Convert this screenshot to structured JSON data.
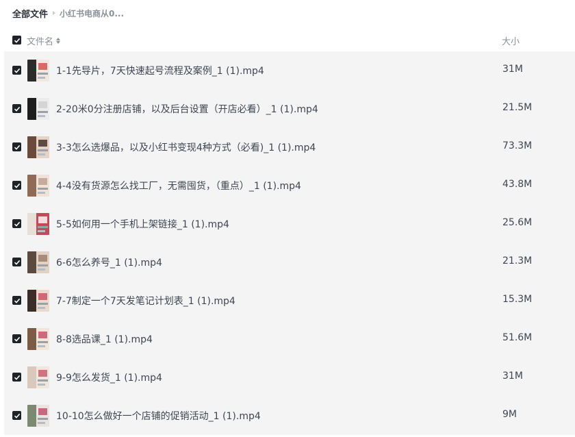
{
  "breadcrumb": {
    "root": "全部文件",
    "current": "小红书电商从0..."
  },
  "header": {
    "name_label": "文件名",
    "size_label": "大小",
    "sort_icon": "sort-icon",
    "checked": true
  },
  "files": [
    {
      "name": "1-1先导片，7天快速起号流程及案例_1 (1).mp4",
      "size": "31M",
      "checked": true,
      "thumbnail": "video-thumbnail"
    },
    {
      "name": "2-20米0分注册店铺，以及后台设置（开店必看）_1 (1).mp4",
      "size": "21.5M",
      "checked": true,
      "thumbnail": "video-thumbnail"
    },
    {
      "name": "3-3怎么选爆品，以及小红书变现4种方式（必看)_1 (1).mp4",
      "size": "73.3M",
      "checked": true,
      "thumbnail": "video-thumbnail"
    },
    {
      "name": "4-4没有货源怎么找工厂，无需囤货，（重点）_1 (1).mp4",
      "size": "43.8M",
      "checked": true,
      "thumbnail": "video-thumbnail"
    },
    {
      "name": "5-5如何用一个手机上架链接_1 (1).mp4",
      "size": "25.6M",
      "checked": true,
      "thumbnail": "video-thumbnail"
    },
    {
      "name": "6-6怎么养号_1 (1).mp4",
      "size": "21.3M",
      "checked": true,
      "thumbnail": "video-thumbnail"
    },
    {
      "name": "7-7制定一个7天发笔记计划表_1 (1).mp4",
      "size": "15.3M",
      "checked": true,
      "thumbnail": "video-thumbnail"
    },
    {
      "name": "8-8选品课_1 (1).mp4",
      "size": "51.6M",
      "checked": true,
      "thumbnail": "video-thumbnail"
    },
    {
      "name": "9-9怎么发货_1 (1).mp4",
      "size": "31M",
      "checked": true,
      "thumbnail": "video-thumbnail"
    },
    {
      "name": "10-10怎么做好一个店铺的促销活动_1 (1).mp4",
      "size": "9M",
      "checked": true,
      "thumbnail": "video-thumbnail"
    }
  ],
  "colors": {
    "row_background": "#f4f4f5",
    "checkbox": "#1f2329",
    "text": "#3e4551",
    "muted": "#8b929c"
  }
}
